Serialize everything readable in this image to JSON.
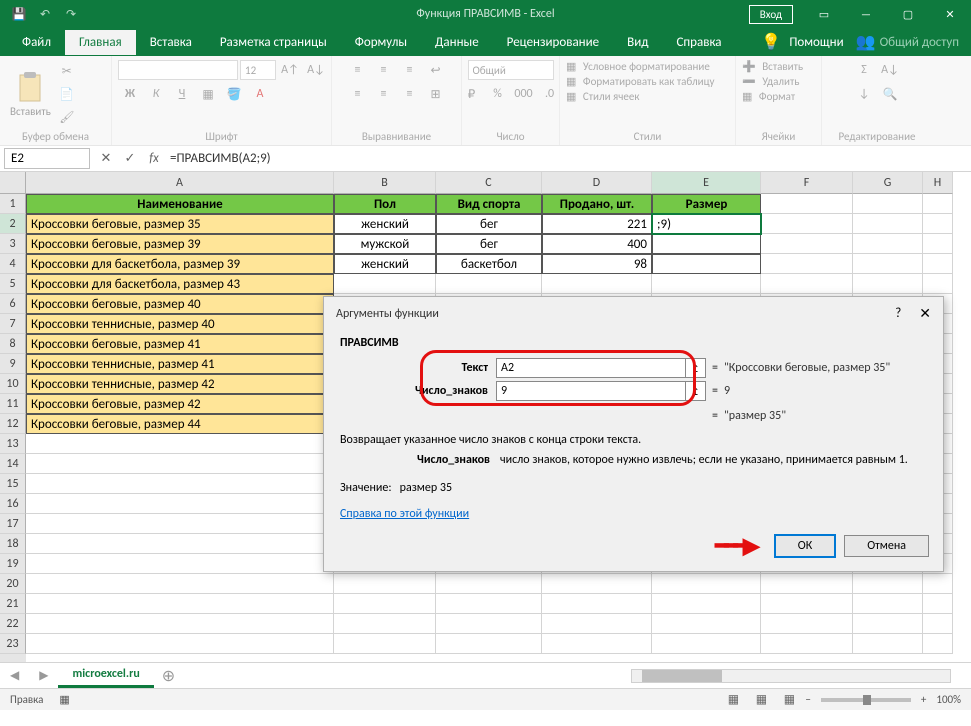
{
  "title": "Функция ПРАВСИМВ  -  Excel",
  "login": "Вход",
  "tabs": [
    "Файл",
    "Главная",
    "Вставка",
    "Разметка страницы",
    "Формулы",
    "Данные",
    "Рецензирование",
    "Вид",
    "Справка"
  ],
  "active_tab": 1,
  "help_btn": "Помощни",
  "share_btn": "Общий доступ",
  "ribbon": {
    "clipboard": {
      "label": "Буфер обмена",
      "paste": "Вставить"
    },
    "font": {
      "label": "Шрифт",
      "size": "12"
    },
    "align": {
      "label": "Выравнивание"
    },
    "number": {
      "label": "Число",
      "format": "Общий"
    },
    "styles": {
      "label": "Стили",
      "s1": "Условное форматирование",
      "s2": "Форматировать как таблицу",
      "s3": "Стили ячеек"
    },
    "cells": {
      "label": "Ячейки",
      "c1": "Вставить",
      "c2": "Удалить",
      "c3": "Формат"
    },
    "editing": {
      "label": "Редактирование"
    }
  },
  "namebox": "E2",
  "formula": "=ПРАВСИМВ(A2;9)",
  "fx_label": "fx",
  "columns": [
    "A",
    "B",
    "C",
    "D",
    "E",
    "F",
    "G",
    "H"
  ],
  "headers": {
    "A": "Наименование",
    "B": "Пол",
    "C": "Вид спорта",
    "D": "Продано, шт.",
    "E": "Размер"
  },
  "rows": [
    {
      "A": "Кроссовки беговые, размер 35",
      "B": "женский",
      "C": "бег",
      "D": "221",
      "E": ";9)"
    },
    {
      "A": "Кроссовки беговые, размер 39",
      "B": "мужской",
      "C": "бег",
      "D": "400",
      "E": ""
    },
    {
      "A": "Кроссовки для баскетбола, размер 39",
      "B": "женский",
      "C": "баскетбол",
      "D": "98",
      "E": ""
    },
    {
      "A": "Кроссовки для баскетбола, размер 43",
      "B": "",
      "C": "",
      "D": "",
      "E": ""
    },
    {
      "A": "Кроссовки беговые, размер 40",
      "B": "",
      "C": "",
      "D": "",
      "E": ""
    },
    {
      "A": "Кроссовки теннисные, размер 40",
      "B": "",
      "C": "",
      "D": "",
      "E": ""
    },
    {
      "A": "Кроссовки беговые, размер 41",
      "B": "",
      "C": "",
      "D": "",
      "E": ""
    },
    {
      "A": "Кроссовки теннисные, размер 41",
      "B": "",
      "C": "",
      "D": "",
      "E": ""
    },
    {
      "A": "Кроссовки теннисные, размер 42",
      "B": "",
      "C": "",
      "D": "",
      "E": ""
    },
    {
      "A": "Кроссовки беговые, размер 42",
      "B": "",
      "C": "",
      "D": "",
      "E": ""
    },
    {
      "A": "Кроссовки беговые, размер 44",
      "B": "",
      "C": "",
      "D": "",
      "E": ""
    }
  ],
  "dialog": {
    "title": "Аргументы функции",
    "func": "ПРАВСИМВ",
    "arg1_label": "Текст",
    "arg1_value": "A2",
    "arg1_result": "\"Кроссовки беговые, размер 35\"",
    "arg2_label": "Число_знаков",
    "arg2_value": "9",
    "arg2_result": "9",
    "final_result": "\"размер 35\"",
    "desc": "Возвращает указанное число знаков с конца строки текста.",
    "arg_desc_name": "Число_знаков",
    "arg_desc_text": "число знаков, которое нужно извлечь; если не указано, принимается равным 1.",
    "value_label": "Значение:",
    "value": "размер 35",
    "help_link": "Справка по этой функции",
    "ok": "ОК",
    "cancel": "Отмена"
  },
  "sheet_tab": "microexcel.ru",
  "status": "Правка",
  "zoom": "100%",
  "qat": {
    "save": "💾"
  }
}
